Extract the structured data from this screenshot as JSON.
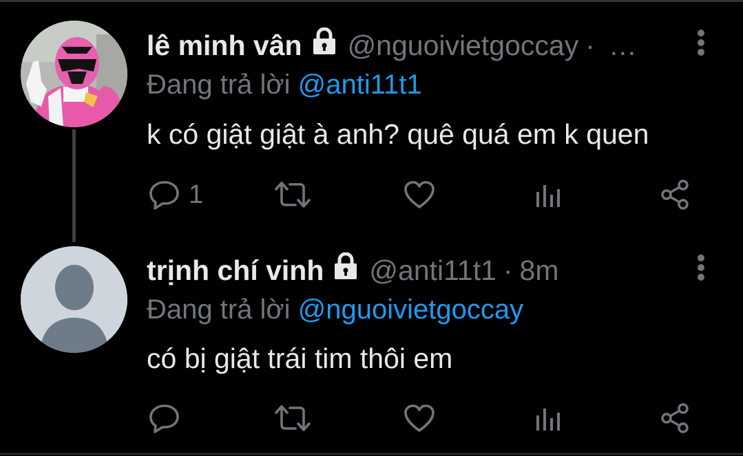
{
  "tweets": [
    {
      "display_name": "lê minh vân",
      "handle": "@nguoivietgoccay",
      "separator": "·",
      "time": "",
      "ellipsis": "…",
      "reply_prefix": "Đang trả lời",
      "reply_to": "@anti11t1",
      "text": "k có giật giật à anh? quê quá em k quen",
      "reply_count": "1",
      "avatar": "pink-ranger-photo"
    },
    {
      "display_name": "trịnh chí vinh",
      "handle": "@anti11t1",
      "separator": "·",
      "time": "8m",
      "ellipsis": "",
      "reply_prefix": "Đang trả lời",
      "reply_to": "@nguoivietgoccay",
      "text": "có bị giật trái tim thôi em",
      "reply_count": "",
      "avatar": "default-profile-silhouette"
    }
  ],
  "icons": {
    "lock": "lock-icon",
    "more": "more-vertical-icon",
    "reply": "reply-icon",
    "retweet": "retweet-icon",
    "like": "heart-icon",
    "views": "analytics-icon",
    "share": "share-icon"
  },
  "colors": {
    "background": "#000000",
    "text_primary": "#e7e9ea",
    "text_secondary": "#71767b",
    "link": "#1d9bf0",
    "thread_line": "#3d4145"
  }
}
